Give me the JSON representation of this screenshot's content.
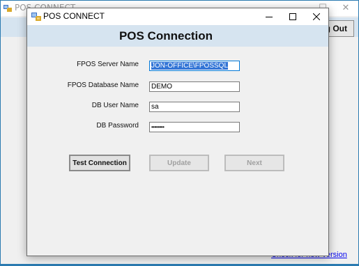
{
  "background_window": {
    "title": "POS CONNECT",
    "logout_label": "g Out",
    "link_text": "Check for new version"
  },
  "dialog": {
    "title": "POS CONNECT",
    "header": "POS Connection",
    "controls": [
      "minimize",
      "maximize",
      "close"
    ],
    "fields": [
      {
        "label": "FPOS Server Name",
        "value": "JON-OFFICE\\FPOSSQL"
      },
      {
        "label": "FPOS Database Name",
        "value": "DEMO"
      },
      {
        "label": "DB User Name",
        "value": "sa"
      },
      {
        "label": "DB Password",
        "value": "••••••••"
      }
    ],
    "buttons": {
      "test": "Test Connection",
      "update": "Update",
      "next": "Next"
    }
  },
  "colors": {
    "header_band": "#d6e4f0",
    "taskbar_accent": "#2a7ab0",
    "selection": "#3375d6",
    "link": "#0000ee"
  }
}
